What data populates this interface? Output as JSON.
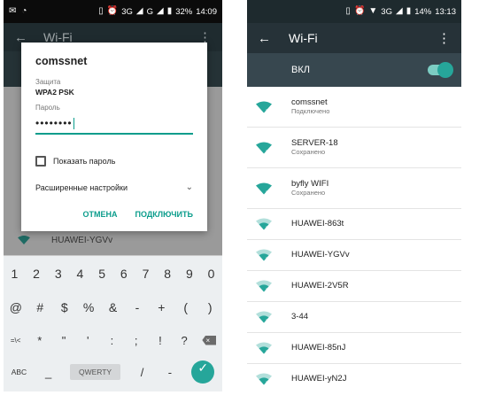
{
  "left_phone": {
    "status": {
      "time": "14:09",
      "battery": "32%",
      "network": "3G",
      "network2": "G"
    },
    "appbar": {
      "title": "Wi-Fi"
    },
    "background_network": "HUAWEI-YGVv",
    "dialog": {
      "title": "comssnet",
      "security_caption": "Защита",
      "security_value": "WPA2 PSK",
      "password_caption": "Пароль",
      "password_value": "••••••••",
      "show_password_label": "Показать пароль",
      "advanced_label": "Расширенные настройки",
      "cancel_label": "ОТМЕНА",
      "connect_label": "ПОДКЛЮЧИТЬ"
    },
    "keyboard": {
      "row1": [
        "1",
        "2",
        "3",
        "4",
        "5",
        "6",
        "7",
        "8",
        "9",
        "0"
      ],
      "row2": [
        "@",
        "#",
        "$",
        "%",
        "&",
        "-",
        "+",
        "(",
        ")"
      ],
      "row3": [
        "=\\<",
        "*",
        "\"",
        "'",
        ":",
        ";",
        "!",
        "?"
      ],
      "row4": {
        "abc": "ABC",
        "underscore": "_",
        "slash": "/",
        "layout": "QWERTY",
        "dash": "-"
      }
    }
  },
  "right_phone": {
    "status": {
      "time": "13:13",
      "battery": "14%",
      "network": "3G"
    },
    "appbar": {
      "title": "Wi-Fi"
    },
    "toggle_label": "ВКЛ",
    "networks": [
      {
        "name": "comssnet",
        "status": "Подключено",
        "strength": "full"
      },
      {
        "name": "SERVER-18",
        "status": "Сохранено",
        "strength": "full"
      },
      {
        "name": "byfly WIFI",
        "status": "Сохранено",
        "strength": "full"
      },
      {
        "name": "HUAWEI-863t",
        "status": "",
        "strength": "partial"
      },
      {
        "name": "HUAWEI-YGVv",
        "status": "",
        "strength": "partial"
      },
      {
        "name": "HUAWEI-2V5R",
        "status": "",
        "strength": "partial"
      },
      {
        "name": "3-44",
        "status": "",
        "strength": "partial"
      },
      {
        "name": "HUAWEI-85nJ",
        "status": "",
        "strength": "partial"
      },
      {
        "name": "HUAWEI-yN2J",
        "status": "",
        "strength": "partial"
      }
    ]
  },
  "colors": {
    "accent": "#26a69a",
    "toolbar": "#263238",
    "toggle_row": "#37474f"
  }
}
